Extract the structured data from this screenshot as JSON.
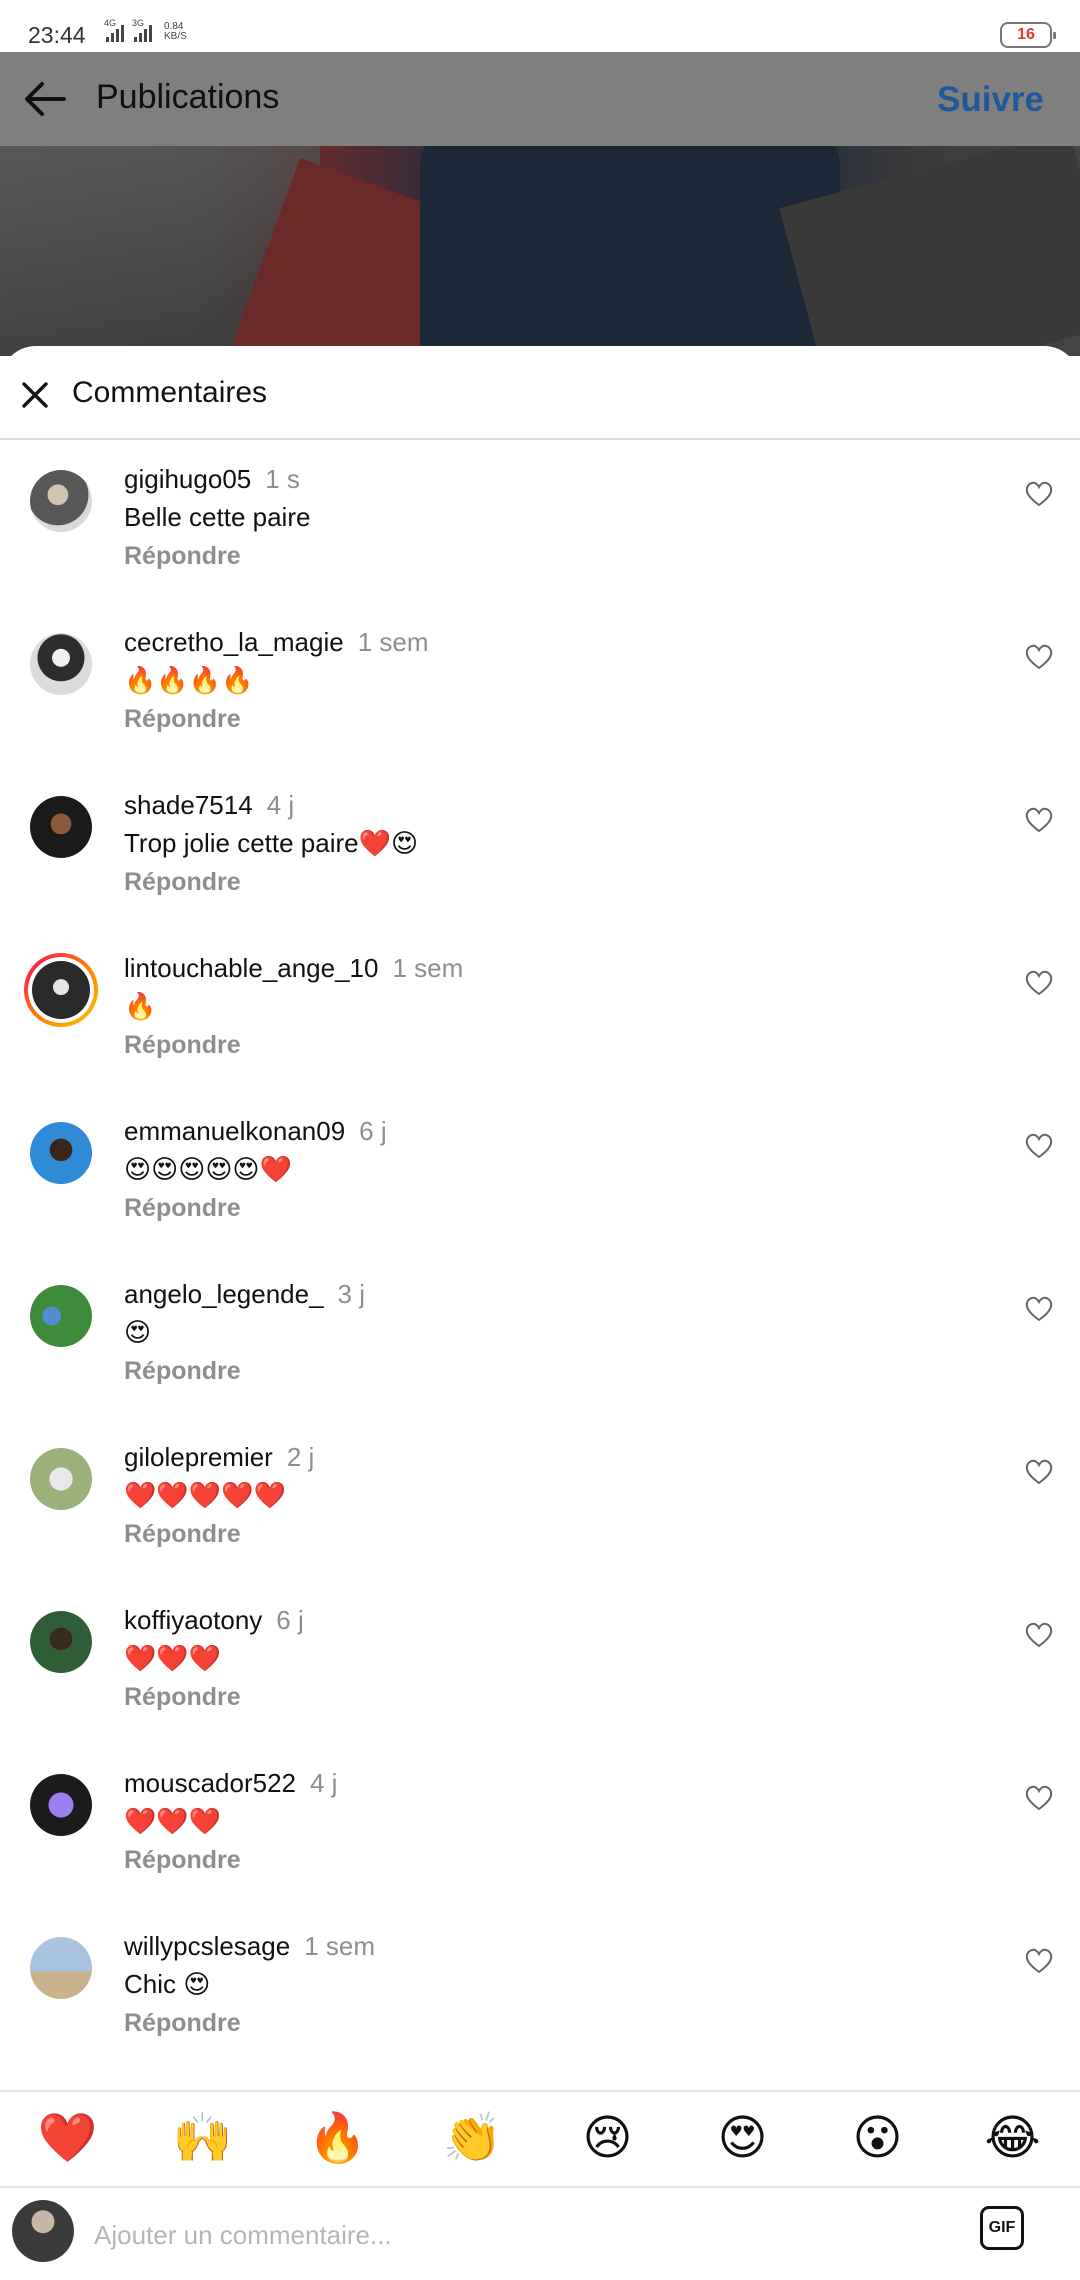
{
  "status_bar": {
    "time": "23:44",
    "network_1": "4G",
    "network_2": "3G",
    "speed_value": "0.84",
    "speed_unit": "KB/S",
    "battery": "16"
  },
  "header": {
    "title": "Publications",
    "follow_label": "Suivre"
  },
  "sheet": {
    "title": "Commentaires"
  },
  "comments": [
    {
      "user": "gigihugo05",
      "time": "1 s",
      "text": "Belle cette paire",
      "reply": "Répondre"
    },
    {
      "user": "cecretho_la_magie",
      "time": "1 sem",
      "text": "🔥🔥🔥🔥",
      "reply": "Répondre"
    },
    {
      "user": "shade7514",
      "time": "4 j",
      "text": "Trop jolie cette paire❤️😍",
      "reply": "Répondre"
    },
    {
      "user": "lintouchable_ange_10",
      "time": "1 sem",
      "text": "🔥",
      "reply": "Répondre"
    },
    {
      "user": "emmanuelkonan09",
      "time": "6 j",
      "text": "😍😍😍😍😍❤️",
      "reply": "Répondre"
    },
    {
      "user": "angelo_legende_",
      "time": "3 j",
      "text": "😍",
      "reply": "Répondre"
    },
    {
      "user": "gilolepremier",
      "time": "2 j",
      "text": "❤️❤️❤️❤️❤️",
      "reply": "Répondre"
    },
    {
      "user": "koffiyaotony",
      "time": "6 j",
      "text": "❤️❤️❤️",
      "reply": "Répondre"
    },
    {
      "user": "mouscador522",
      "time": "4 j",
      "text": "❤️❤️❤️",
      "reply": "Répondre"
    },
    {
      "user": "willypcslesage",
      "time": "1 sem",
      "text": "Chic 😍",
      "reply": "Répondre"
    }
  ],
  "reactions": [
    "❤️",
    "🙌",
    "🔥",
    "👏",
    "😢",
    "😍",
    "😮",
    "😂"
  ],
  "input": {
    "placeholder": "Ajouter un commentaire...",
    "gif_label": "GIF"
  },
  "colors": {
    "follow": "#1e5a9a",
    "header_bg": "#7f7f7f",
    "secondary_text": "#8e8e8e"
  }
}
